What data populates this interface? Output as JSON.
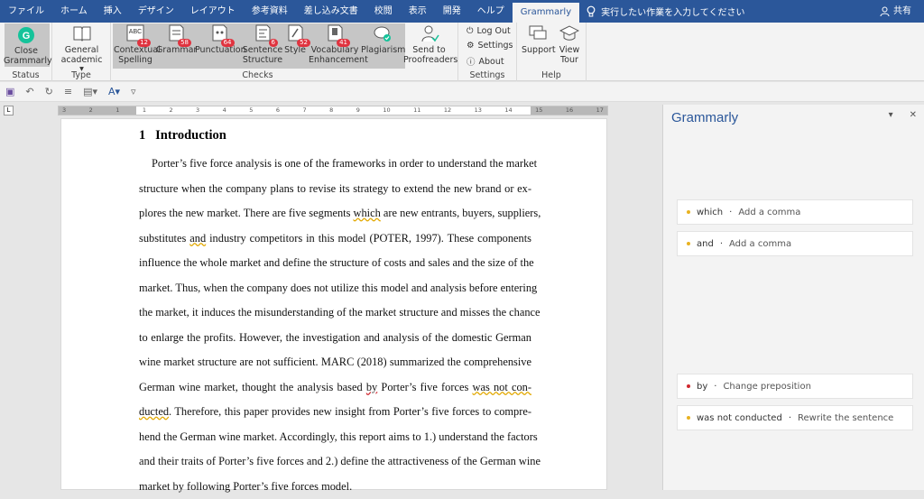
{
  "tabs": [
    "ファイル",
    "ホーム",
    "挿入",
    "デザイン",
    "レイアウト",
    "参考資料",
    "差し込み文書",
    "校閲",
    "表示",
    "開発",
    "ヘルプ",
    "Grammarly"
  ],
  "tellme": "実行したい作業を入力してください",
  "share": "共有",
  "ribbon": {
    "status": {
      "label": "Status",
      "button": "Close",
      "button2": "Grammarly"
    },
    "type": {
      "label": "Type",
      "button": "General",
      "button2": "academic"
    },
    "checks": {
      "label": "Checks",
      "items": [
        {
          "name": "Contextual",
          "name2": "Spelling",
          "count": "12"
        },
        {
          "name": "Grammar",
          "name2": "",
          "count": "58"
        },
        {
          "name": "Punctuation",
          "name2": "",
          "count": "64"
        },
        {
          "name": "Sentence",
          "name2": "Structure",
          "count": "6"
        },
        {
          "name": "Style",
          "name2": "",
          "count": "52"
        },
        {
          "name": "Vocabulary",
          "name2": "Enhancement",
          "count": "41"
        },
        {
          "name": "Plagiarism",
          "name2": "",
          "count": ""
        }
      ]
    },
    "send": {
      "line1": "Send to",
      "line2": "Proofreaders"
    },
    "settings": {
      "label": "Settings",
      "logout": "Log Out",
      "settings": "Settings",
      "about": "About"
    },
    "help": {
      "label": "Help",
      "support": "Support",
      "view": "View",
      "tour": "Tour"
    }
  },
  "doc": {
    "heading_num": "1",
    "heading": "Introduction",
    "lines": [
      "Porter’s five force analysis is one of the frameworks in order to understand the market",
      "structure when the company plans to revise its strategy to extend the new brand or ex-",
      "plores the new market. There are five segments which are new entrants, buyers, suppliers,",
      "substitutes and industry competitors in this model (POTER, 1997). These components",
      "influence the whole market and define the structure of costs and sales and the size of the",
      "market. Thus, when the company does not utilize this model and analysis before entering",
      "the market, it induces the misunderstanding of the market structure and misses the chance",
      "to enlarge the profits. However, the investigation and analysis of the domestic German",
      "wine market structure are not sufficient. MARC (2018) summarized the comprehensive",
      "German wine market, thought the analysis based by Porter’s five forces was not con-",
      "ducted. Therefore, this paper provides new insight from Porter’s five forces to compre-",
      "hend the German wine market. Accordingly, this report aims to 1.) understand the factors",
      "and their traits of Porter’s five forces and 2.) define the attractiveness of the German wine",
      "market by following Porter’s five forces model."
    ]
  },
  "ruler": [
    "3",
    "2",
    "1",
    "1",
    "2",
    "3",
    "4",
    "5",
    "6",
    "7",
    "8",
    "9",
    "10",
    "11",
    "12",
    "13",
    "14",
    "15",
    "16",
    "17"
  ],
  "pane": {
    "title": "Grammarly",
    "cards": [
      {
        "word": "which",
        "suggestion": "Add a comma",
        "color": "#e8b221"
      },
      {
        "word": "and",
        "suggestion": "Add a comma",
        "color": "#e8b221"
      },
      {
        "word": "by",
        "suggestion": "Change preposition",
        "color": "#d0282f"
      },
      {
        "word": "was not conducted",
        "suggestion": "Rewrite the sentence",
        "color": "#e8b221"
      }
    ]
  }
}
